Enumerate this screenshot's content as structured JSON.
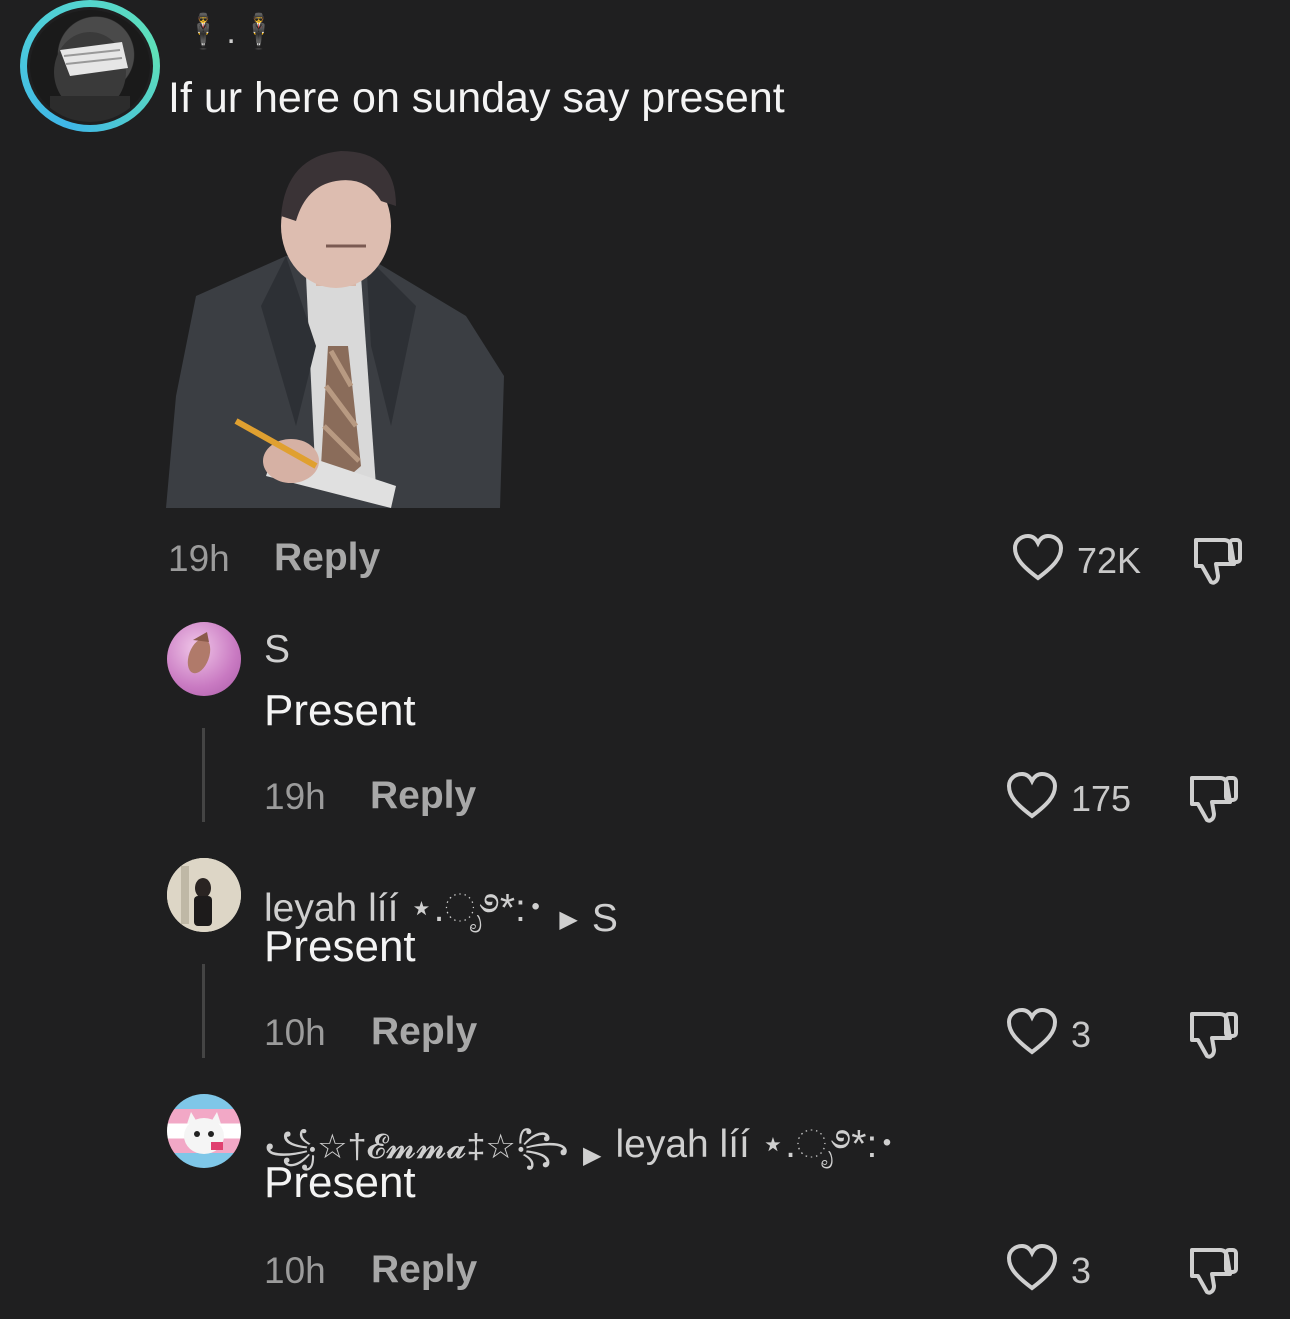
{
  "post": {
    "username": "🕴.🕴",
    "text": "If ur here on sunday say present",
    "time": "19h",
    "reply_label": "Reply",
    "likes": "72K"
  },
  "replies": [
    {
      "name": "S",
      "reply_to": "",
      "text": "Present",
      "time": "19h",
      "reply_label": "Reply",
      "likes": "175"
    },
    {
      "name": "leyah líí ⋆.ೃ࿔*:･",
      "reply_to": "S",
      "text": "Present",
      "time": "10h",
      "reply_label": "Reply",
      "likes": "3"
    },
    {
      "name": "꧁☆†𝓔𝓶𝓶𝓪‡☆꧂",
      "reply_to": "leyah líí ⋆.ೃ࿔*:･",
      "text": "Present",
      "time": "10h",
      "reply_label": "Reply",
      "likes": "3"
    }
  ],
  "colors": {
    "background": "#1f1f20",
    "ring": "#3fb6e8",
    "muted": "#9b9b9b"
  }
}
